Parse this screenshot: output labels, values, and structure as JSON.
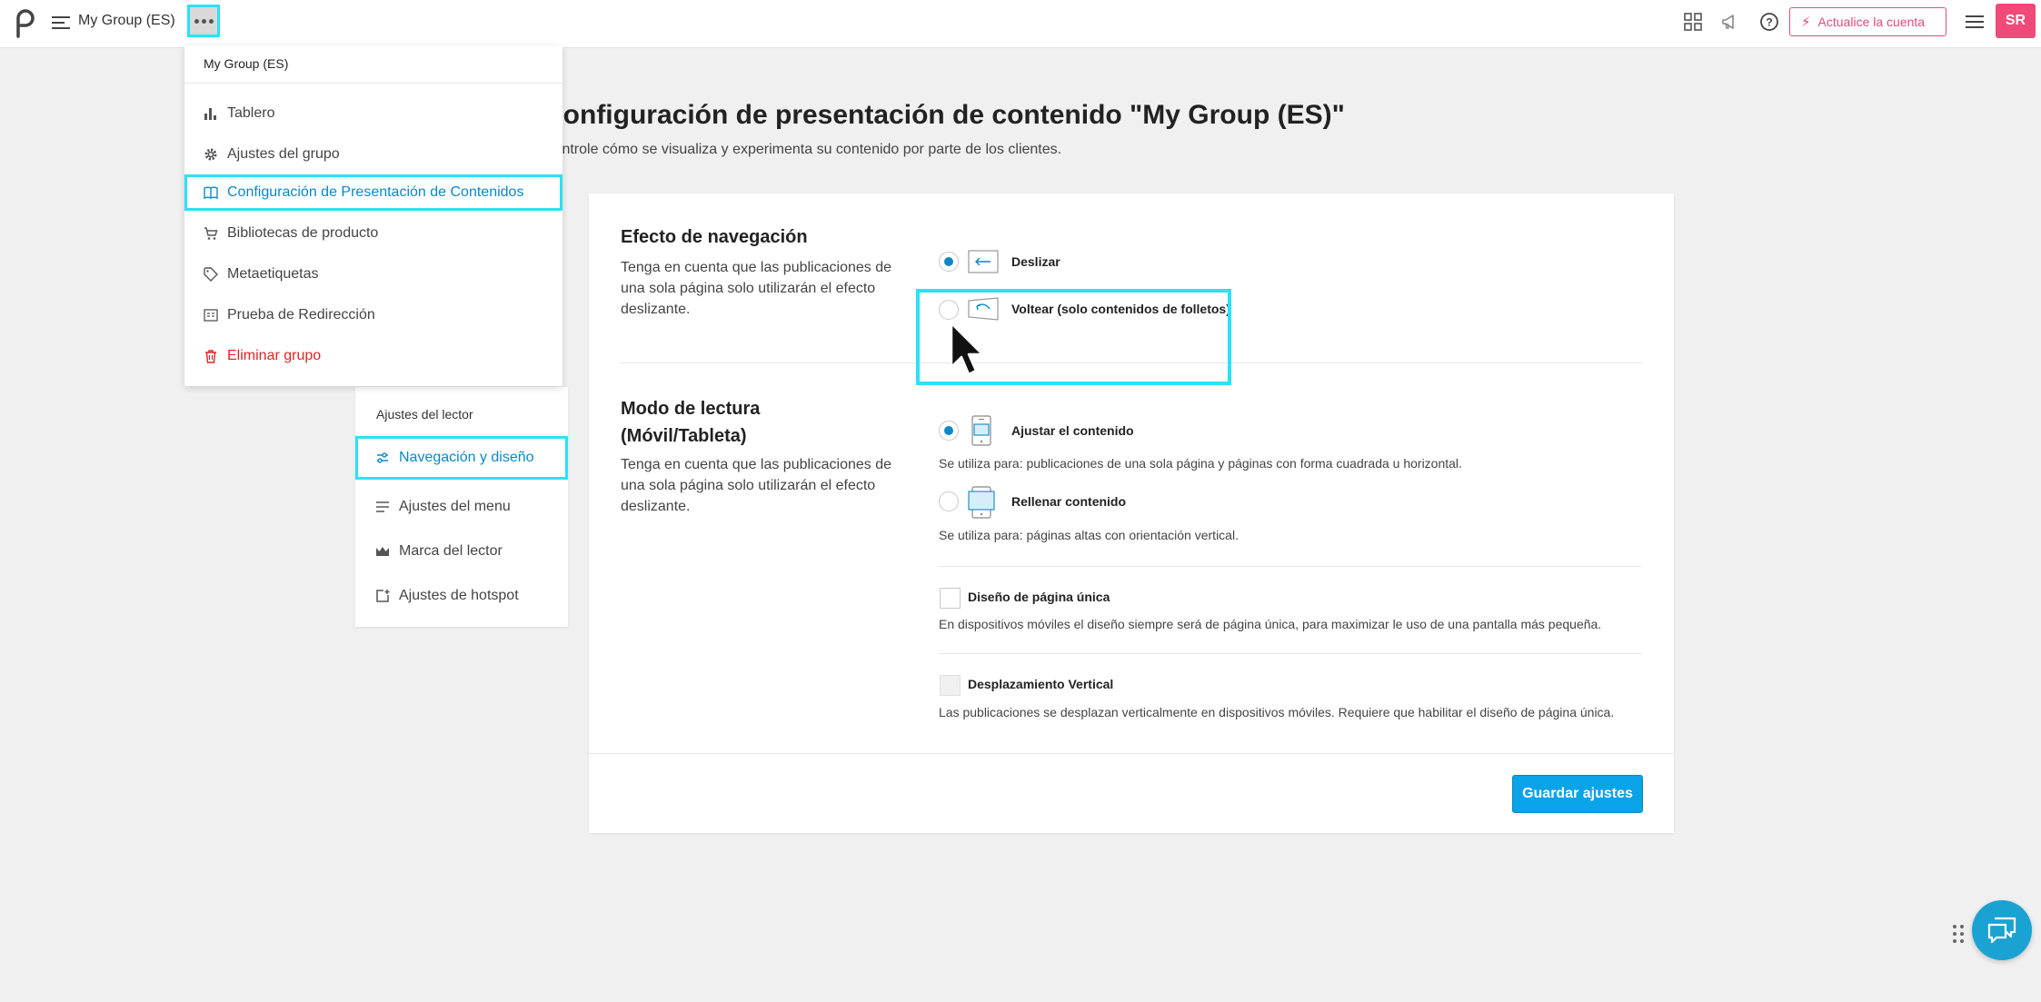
{
  "topbar": {
    "group_name": "My Group (ES)",
    "upgrade_label": "Actualice la cuenta",
    "avatar_initials": "SR"
  },
  "page": {
    "title": "Configuración de presentación de contenido \"My Group (ES)\"",
    "subtitle": "Controle cómo se visualiza y experimenta su contenido por parte de los clientes."
  },
  "dropdown": {
    "header": "My Group (ES)",
    "items": [
      {
        "label": "Tablero",
        "icon": "bar-chart-icon"
      },
      {
        "label": "Ajustes del grupo",
        "icon": "gear-icon"
      },
      {
        "label": "Configuración de Presentación de Contenidos",
        "icon": "book-icon"
      },
      {
        "label": "Bibliotecas de producto",
        "icon": "cart-icon"
      },
      {
        "label": "Metaetiquetas",
        "icon": "tag-icon"
      },
      {
        "label": "Prueba de Redirección",
        "icon": "redirect-icon"
      },
      {
        "label": "Eliminar grupo",
        "icon": "trash-icon"
      }
    ]
  },
  "sidenav": {
    "title": "Ajustes del lector",
    "items": [
      {
        "label": "Navegación y diseño",
        "icon": "sliders-icon"
      },
      {
        "label": "Ajustes del menu",
        "icon": "lines-icon"
      },
      {
        "label": "Marca del lector",
        "icon": "crown-icon"
      },
      {
        "label": "Ajustes de hotspot",
        "icon": "hotspot-icon"
      }
    ]
  },
  "navigation_effect": {
    "title": "Efecto de navegación",
    "description": "Tenga en cuenta que las publicaciones de una sola página solo utilizarán el efecto deslizante.",
    "options": [
      {
        "label": "Deslizar",
        "selected": true
      },
      {
        "label": "Voltear (solo contenidos de folletos)",
        "selected": false
      }
    ]
  },
  "reading_mode": {
    "title_line1": "Modo de lectura",
    "title_line2": "(Móvil/Tableta)",
    "description": "Tenga en cuenta que las publicaciones de una sola página solo utilizarán el efecto deslizante.",
    "options": [
      {
        "label": "Ajustar el contenido",
        "help": "Se utiliza para: publicaciones de una sola página y páginas con forma cuadrada u horizontal.",
        "selected": true
      },
      {
        "label": "Rellenar contenido",
        "help": "Se utiliza para: páginas altas con orientación vertical.",
        "selected": false
      }
    ],
    "checkboxes": [
      {
        "label": "Diseño de página única",
        "help": "En dispositivos móviles el diseño siempre será de página única, para maximizar le uso de una pantalla más pequeña.",
        "checked": false,
        "disabled": false
      },
      {
        "label": "Desplazamiento Vertical",
        "help": "Las publicaciones se desplazan verticalmente en dispositivos móviles. Requiere que habilitar el diseño de página única.",
        "checked": false,
        "disabled": true
      }
    ]
  },
  "save_label": "Guardar ajustes",
  "colors": {
    "accent": "#0a88c7",
    "highlight": "#2ce1f5",
    "upgrade": "#e5487a",
    "danger": "#e02424"
  }
}
